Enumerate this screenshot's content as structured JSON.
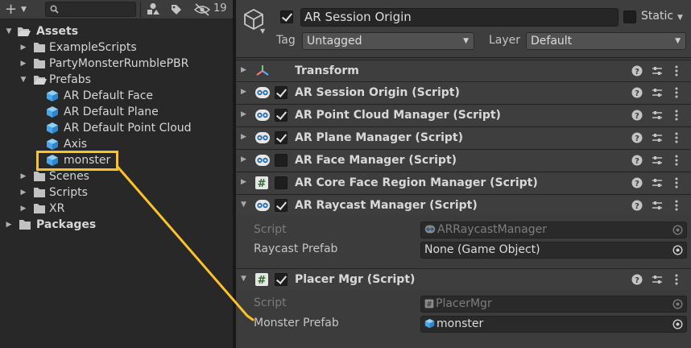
{
  "project": {
    "toolbar": {
      "add_label": "+",
      "search_placeholder": "",
      "hidden_count": "19"
    },
    "tree": {
      "assets": "Assets",
      "example_scripts": "ExampleScripts",
      "party_monster": "PartyMonsterRumblePBR",
      "prefabs": "Prefabs",
      "ar_default_face": "AR Default Face",
      "ar_default_plane": "AR Default Plane",
      "ar_default_point_cloud": "AR Default Point Cloud",
      "axis": "Axis",
      "monster": "monster",
      "scenes": "Scenes",
      "scripts": "Scripts",
      "xr": "XR",
      "packages": "Packages"
    }
  },
  "inspector": {
    "object_name": "AR Session Origin",
    "active": true,
    "static_label": "Static",
    "tag_label": "Tag",
    "tag_value": "Untagged",
    "layer_label": "Layer",
    "layer_value": "Default",
    "components": {
      "transform": "Transform",
      "session_origin": "AR Session Origin (Script)",
      "point_cloud": "AR Point Cloud Manager (Script)",
      "plane": "AR Plane Manager (Script)",
      "face": "AR Face Manager (Script)",
      "core_face": "AR Core Face Region Manager (Script)",
      "raycast": "AR Raycast Manager (Script)",
      "placer": "Placer Mgr (Script)"
    },
    "raycast_props": {
      "script_label": "Script",
      "script_value": "ARRaycastManager",
      "prefab_label": "Raycast Prefab",
      "prefab_value": "None (Game Object)"
    },
    "placer_props": {
      "script_label": "Script",
      "script_value": "PlacerMgr",
      "prefab_label": "Monster Prefab",
      "prefab_value": "monster"
    }
  },
  "colors": {
    "highlight": "#fdc129",
    "prefab_icon": "#5fb3ee",
    "panel_dark": "#282828",
    "inspector_bg": "#3c3c3c"
  },
  "icons": {
    "gameobject": "cube-outline-icon",
    "prefab": "blue-cube-icon",
    "folder": "folder-icon",
    "script_ar": "ar-foundation-icon",
    "script_cs": "csharp-hash-icon",
    "help": "help-icon",
    "preset": "preset-sliders-icon",
    "more": "kebab-menu-icon",
    "picker": "object-picker-icon"
  }
}
